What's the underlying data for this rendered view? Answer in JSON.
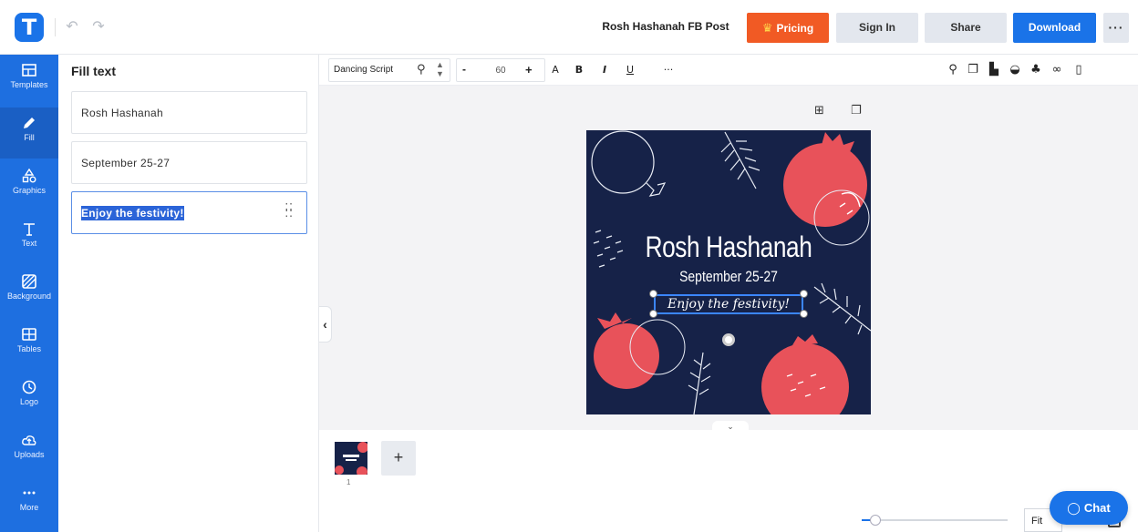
{
  "header": {
    "logo": "T",
    "doc_title": "Rosh Hashanah FB Post",
    "pricing": "Pricing",
    "sign_in": "Sign In",
    "share": "Share",
    "download": "Download",
    "more": "···"
  },
  "rail": {
    "items": [
      {
        "label": "Templates",
        "icon": "templates-icon"
      },
      {
        "label": "Fill",
        "icon": "pencil-icon"
      },
      {
        "label": "Graphics",
        "icon": "shapes-icon"
      },
      {
        "label": "Text",
        "icon": "text-icon"
      },
      {
        "label": "Background",
        "icon": "background-icon"
      },
      {
        "label": "Tables",
        "icon": "table-icon"
      },
      {
        "label": "Logo",
        "icon": "logo-icon"
      },
      {
        "label": "Uploads",
        "icon": "cloud-upload-icon"
      },
      {
        "label": "More",
        "icon": "dots-icon"
      }
    ]
  },
  "panel": {
    "title": "Fill text",
    "fields": [
      "Rosh Hashanah",
      "September 25-27",
      "Enjoy the festivity!"
    ]
  },
  "toolbar": {
    "font": "Dancing Script",
    "font_size": "60",
    "minus": "-",
    "plus": "+",
    "a": "A",
    "bold": "B",
    "italic": "I",
    "underline": "U",
    "more": "···"
  },
  "design": {
    "title": "Rosh Hashanah",
    "date": "September 25-27",
    "tagline": "Enjoy the festivity!",
    "bg_color": "#162248",
    "accent_color": "#e8525a"
  },
  "pages": {
    "page_number": "1",
    "add": "+"
  },
  "footer": {
    "zoom_label": "Fit",
    "chat": "Chat"
  }
}
